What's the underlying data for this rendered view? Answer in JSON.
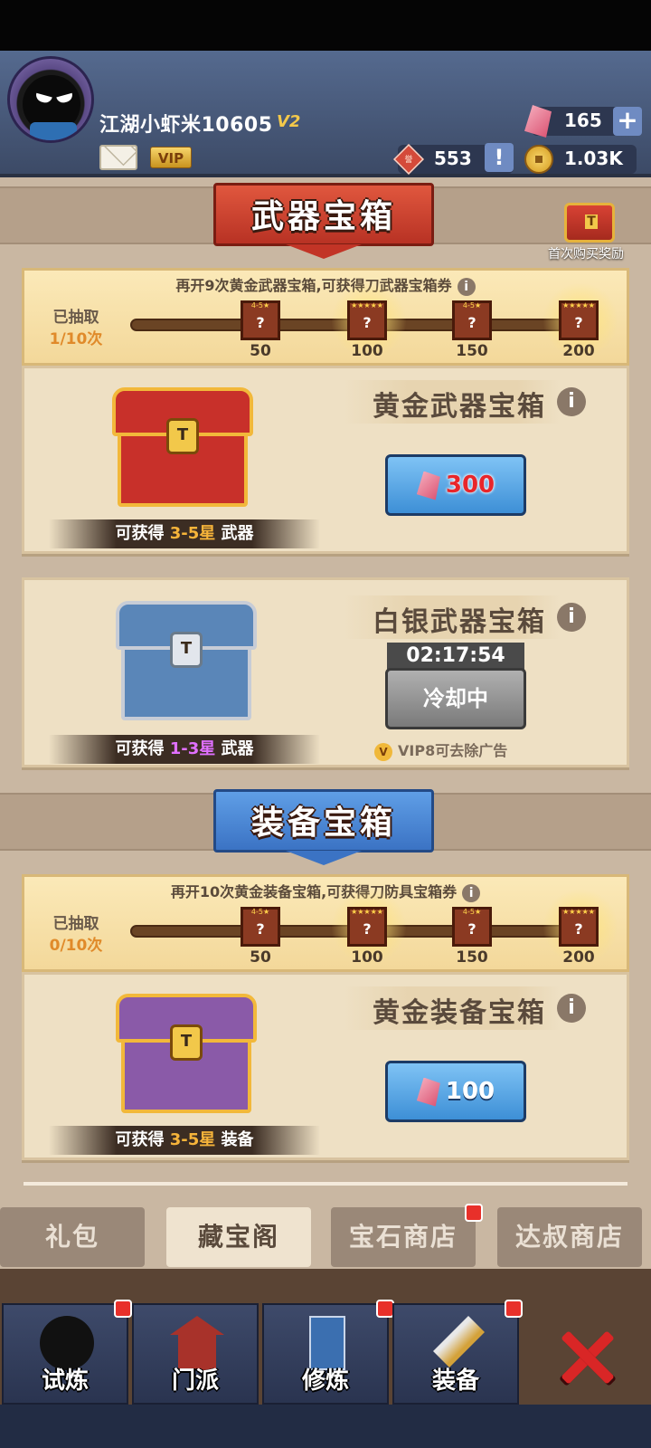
{
  "header": {
    "player_name": "江湖小虾米10605",
    "vip_level": "V2",
    "vip_badge": "VIP",
    "gems": "165",
    "honor": "553",
    "coins": "1.03K",
    "gem_add": "+",
    "honor_info": "!",
    "honor_icon_text": "誉"
  },
  "weapon_section": {
    "title": "武器宝箱",
    "first_buy_label": "首次购买奖励",
    "progress": {
      "tip": "再开9次黄金武器宝箱,可获得刀武器宝箱券",
      "drawn_label": "已抽取",
      "drawn_count": "1/10次",
      "milestones": [
        "50",
        "100",
        "150",
        "200"
      ],
      "milestone_stars": [
        "4-5★",
        "★★★★★",
        "4-5★",
        "★★★★★"
      ]
    },
    "gold_chest": {
      "title": "黄金武器宝箱",
      "reward_prefix": "可获得",
      "reward_stars": "3-5星",
      "reward_suffix": "武器",
      "price": "300"
    },
    "silver_chest": {
      "title": "白银武器宝箱",
      "reward_prefix": "可获得",
      "reward_stars": "1-3星",
      "reward_suffix": "武器",
      "timer": "02:17:54",
      "button": "冷却中",
      "vip_note": "VIP8可去除广告",
      "vip_coin": "V"
    }
  },
  "equipment_section": {
    "title": "装备宝箱",
    "progress": {
      "tip": "再开10次黄金装备宝箱,可获得刀防具宝箱券",
      "drawn_label": "已抽取",
      "drawn_count": "0/10次",
      "milestones": [
        "50",
        "100",
        "150",
        "200"
      ],
      "milestone_stars": [
        "4-5★",
        "★★★★★",
        "4-5★",
        "★★★★★"
      ]
    },
    "gold_chest": {
      "title": "黄金装备宝箱",
      "reward_prefix": "可获得",
      "reward_stars": "3-5星",
      "reward_suffix": "装备",
      "price": "100"
    }
  },
  "shop_tabs": [
    "礼包",
    "藏宝阁",
    "宝石商店",
    "达叔商店"
  ],
  "bottom_nav": [
    "试炼",
    "门派",
    "修炼",
    "装备"
  ],
  "colors": {
    "accent_gold": "#f6b43a",
    "accent_purple": "#e070ff",
    "price_red": "#e8262a",
    "badge_red": "#e8302a"
  },
  "icons": {
    "info": "i",
    "question": "?",
    "chest_lock": "T"
  }
}
